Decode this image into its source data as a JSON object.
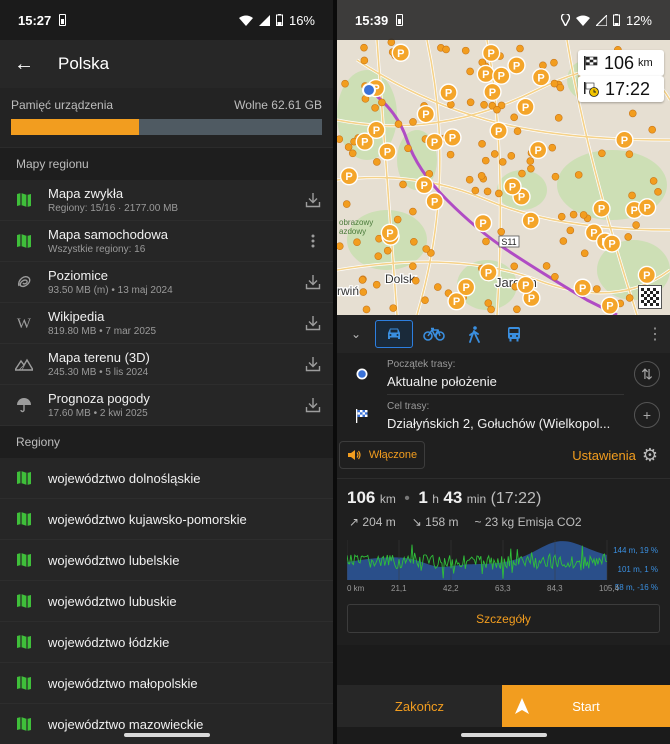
{
  "left": {
    "status": {
      "time": "15:27",
      "battery": "16%"
    },
    "appbar": {
      "title": "Polska"
    },
    "storage": {
      "label": "Pamięć urządzenia",
      "free": "Wolne 62.61 GB",
      "used_fraction": 0.41
    },
    "maps_header": "Mapy regionu",
    "maps": [
      {
        "name": "Mapa zwykła",
        "sub": "Regiony: 15/16 · 2177.00 MB",
        "icon": "map-icon",
        "action": "download-icon"
      },
      {
        "name": "Mapa samochodowa",
        "sub": "Wszystkie regiony: 16",
        "icon": "map-icon",
        "action": "more-icon"
      },
      {
        "name": "Poziomice",
        "sub": "93.50 MB (m) • 13 maj 2024",
        "icon": "contour-icon",
        "action": "download-icon"
      },
      {
        "name": "Wikipedia",
        "sub": "819.80 MB • 7 mar 2025",
        "icon": "wikipedia-icon",
        "action": "download-icon"
      },
      {
        "name": "Mapa terenu (3D)",
        "sub": "245.30 MB • 5 lis 2024",
        "icon": "terrain-icon",
        "action": "download-icon"
      },
      {
        "name": "Prognoza pogody",
        "sub": "17.60 MB • 2 kwi 2025",
        "icon": "umbrella-icon",
        "action": "download-icon"
      }
    ],
    "regions_header": "Regiony",
    "regions": [
      "województwo dolnośląskie",
      "województwo kujawsko-pomorskie",
      "województwo lubelskie",
      "województwo lubuskie",
      "województwo łódzkie",
      "województwo małopolskie",
      "województwo mazowieckie"
    ]
  },
  "right": {
    "status": {
      "time": "15:39",
      "battery": "12%"
    },
    "map": {
      "distance_value": "106",
      "distance_unit": "km",
      "arrival_time": "17:22",
      "labels": {
        "dolsk": "Dolsk",
        "jarocin": "Jarocin",
        "road": "S11",
        "park": "obrazowy\nazdowy",
        "win": "rwiń"
      }
    },
    "modes": [
      "car-icon",
      "bicycle-icon",
      "pedestrian-icon",
      "bus-icon"
    ],
    "start": {
      "label": "Początek trasy:",
      "value": "Aktualne położenie"
    },
    "destination": {
      "label": "Cel trasy:",
      "value": "Działyńskich 2, Gołuchów (Wielkopol..."
    },
    "sound_label": "Włączone",
    "settings_label": "Ustawienia",
    "summary": {
      "distance": "106",
      "distance_unit": "km",
      "hours": "1",
      "hours_unit": "h",
      "minutes": "43",
      "minutes_unit": "min",
      "eta": "(17:22)",
      "ascent": "204 m",
      "descent": "158 m",
      "emission": "~ 23 kg Emisja CO2"
    },
    "chart_data": {
      "type": "area",
      "x_ticks": [
        "0 km",
        "21,1",
        "42,2",
        "63,3",
        "84,3",
        "105,4"
      ],
      "right_labels": [
        {
          "text": "144 m, 19 %",
          "color": "#3a8fe0"
        },
        {
          "text": "101 m, 1 %",
          "color": "#3a8fe0"
        },
        {
          "text": "58 m, -16 %",
          "color": "#3a8fe0"
        }
      ],
      "elevation_range": [
        58,
        144
      ],
      "colors": {
        "elevation": "#2a4f8a",
        "slope": "#2fbf3a"
      }
    },
    "details_label": "Szczegóły",
    "stop_label": "Zakończ",
    "start_label": "Start",
    "accent": "#f29d1f"
  }
}
